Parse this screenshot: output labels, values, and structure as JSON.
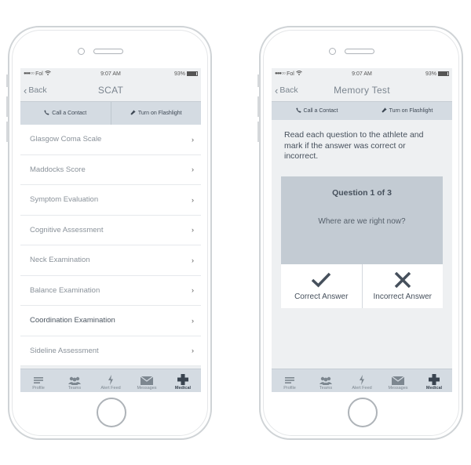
{
  "status_bar": {
    "carrier": "Fol",
    "time": "9:07 AM",
    "battery": "93%",
    "battery_level": 0.93
  },
  "left_screen": {
    "back_label": "Back",
    "title": "SCAT",
    "actions": {
      "call": "Call a Contact",
      "flashlight": "Turn on Flashlight"
    },
    "menu": [
      {
        "label": "Glasgow Coma Scale"
      },
      {
        "label": "Maddocks Score"
      },
      {
        "label": "Symptom Evaluation"
      },
      {
        "label": "Cognitive Assessment"
      },
      {
        "label": "Neck Examination"
      },
      {
        "label": "Balance Examination"
      },
      {
        "label": "Coordination Examination"
      },
      {
        "label": "Sideline Assessment"
      }
    ]
  },
  "right_screen": {
    "back_label": "Back",
    "title": "Memory Test",
    "actions": {
      "call": "Call a Contact",
      "flashlight": "Turn on Flashlight"
    },
    "instructions": "Read each question to the athlete and mark if the answer was correct or incorrect.",
    "question_number": "Question 1 of 3",
    "question_text": "Where are we right now?",
    "correct_label": "Correct Answer",
    "incorrect_label": "Incorrect Answer"
  },
  "tabs": [
    {
      "label": "Profile",
      "icon": "list-icon"
    },
    {
      "label": "Teams",
      "icon": "people-icon"
    },
    {
      "label": "Alert Feed",
      "icon": "lightning-icon"
    },
    {
      "label": "Messages",
      "icon": "envelope-icon"
    },
    {
      "label": "Medical",
      "icon": "medical-cross-icon",
      "active": true
    }
  ],
  "colors": {
    "tabbar_bg": "#d4dbe2",
    "question_card_bg": "#c3cbd3",
    "screen_bg": "#eef0f2"
  }
}
